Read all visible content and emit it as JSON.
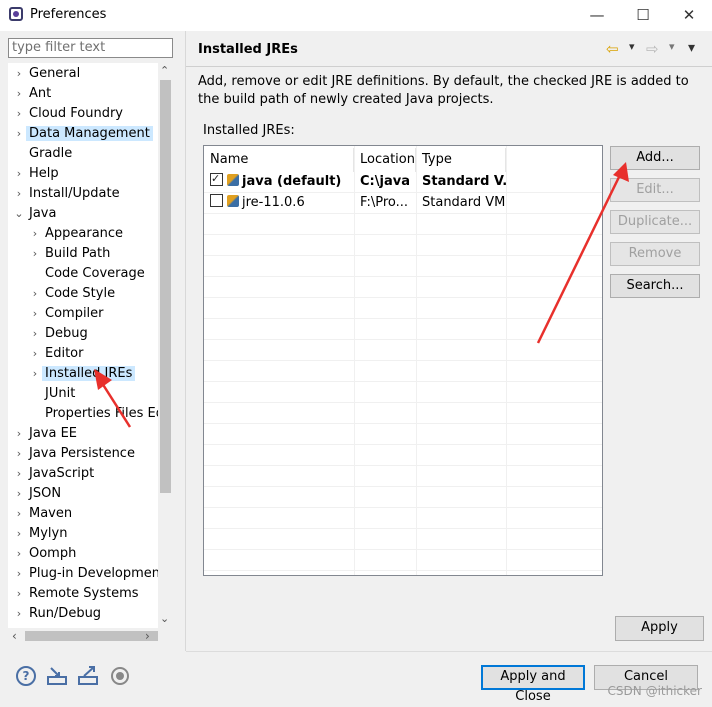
{
  "window": {
    "title": "Preferences",
    "minimize_glyph": "—",
    "maximize_glyph": "☐",
    "close_glyph": "✕"
  },
  "filter": {
    "placeholder": "type filter text"
  },
  "tree": {
    "items": [
      {
        "label": "General",
        "chev": "›"
      },
      {
        "label": "Ant",
        "chev": "›"
      },
      {
        "label": "Cloud Foundry",
        "chev": "›"
      },
      {
        "label": "Data Management",
        "chev": "›"
      },
      {
        "label": "Gradle",
        "chev": ""
      },
      {
        "label": "Help",
        "chev": "›"
      },
      {
        "label": "Install/Update",
        "chev": "›"
      },
      {
        "label": "Java",
        "chev": "⌄"
      },
      {
        "label": "Appearance",
        "chev": "›"
      },
      {
        "label": "Build Path",
        "chev": "›"
      },
      {
        "label": "Code Coverage",
        "chev": ""
      },
      {
        "label": "Code Style",
        "chev": "›"
      },
      {
        "label": "Compiler",
        "chev": "›"
      },
      {
        "label": "Debug",
        "chev": "›"
      },
      {
        "label": "Editor",
        "chev": "›"
      },
      {
        "label": "Installed JREs",
        "chev": "›"
      },
      {
        "label": "JUnit",
        "chev": ""
      },
      {
        "label": "Properties Files Edit",
        "chev": ""
      },
      {
        "label": "Java EE",
        "chev": "›"
      },
      {
        "label": "Java Persistence",
        "chev": "›"
      },
      {
        "label": "JavaScript",
        "chev": "›"
      },
      {
        "label": "JSON",
        "chev": "›"
      },
      {
        "label": "Maven",
        "chev": "›"
      },
      {
        "label": "Mylyn",
        "chev": "›"
      },
      {
        "label": "Oomph",
        "chev": "›"
      },
      {
        "label": "Plug-in Development",
        "chev": "›"
      },
      {
        "label": "Remote Systems",
        "chev": "›"
      },
      {
        "label": "Run/Debug",
        "chev": "›"
      }
    ],
    "scroll_up": "⌃",
    "scroll_down": "⌄",
    "scroll_left": "‹",
    "scroll_right": "›"
  },
  "page": {
    "title": "Installed JREs",
    "description": "Add, remove or edit JRE definitions. By default, the checked JRE is added to the build path of newly created Java projects.",
    "list_label": "Installed JREs:",
    "nav_back": "⇦",
    "nav_forward": "⇨",
    "menu": "▾"
  },
  "table": {
    "columns": [
      "Name",
      "Location",
      "Type"
    ],
    "rows": [
      {
        "checked": true,
        "name": "java (default)",
        "location": "C:\\java",
        "type": "Standard V..."
      },
      {
        "checked": false,
        "name": "jre-11.0.6",
        "location": "F:\\Pro...",
        "type": "Standard VM"
      }
    ]
  },
  "buttons": {
    "add": "Add...",
    "edit": "Edit...",
    "duplicate": "Duplicate...",
    "remove": "Remove",
    "search": "Search...",
    "apply": "Apply",
    "apply_close": "Apply and Close",
    "cancel": "Cancel"
  },
  "footer": {
    "help_glyph": "?"
  },
  "watermark": "CSDN @ithicker",
  "colors": {
    "selection": "#cce8ff",
    "arrow": "#e8302c",
    "default_border": "#0078d7"
  }
}
